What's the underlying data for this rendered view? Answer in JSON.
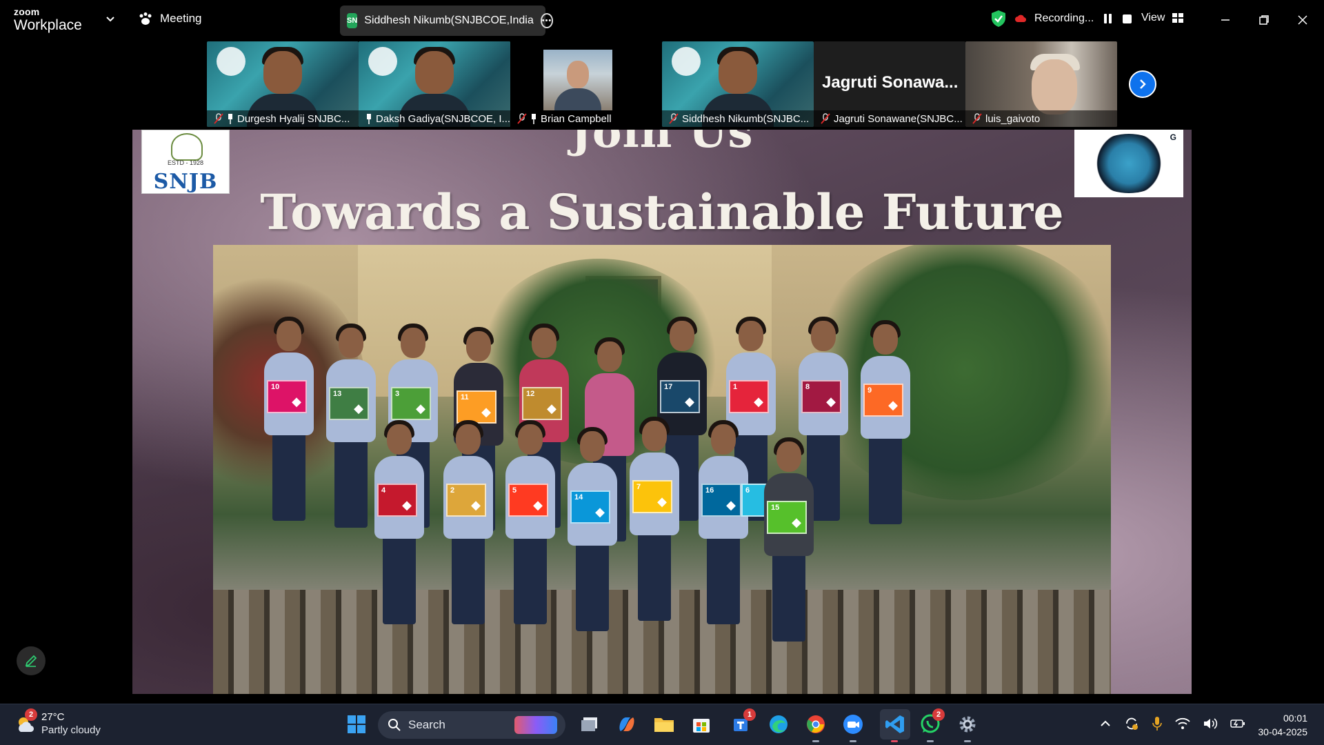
{
  "app": {
    "brand_small": "zoom",
    "brand_name": "Workplace",
    "meeting_label": "Meeting",
    "speaker_initials": "SN",
    "speaker_name": "Siddhesh Nikumb(SNJBCOE,India",
    "recording_label": "Recording...",
    "view_label": "View"
  },
  "participants": [
    {
      "name": "Durgesh Hyalij SNJBC...",
      "muted": true,
      "pinned": true,
      "type": "video"
    },
    {
      "name": "Daksh Gadiya(SNJBCOE, I...",
      "muted": false,
      "pinned": true,
      "type": "video",
      "active": true
    },
    {
      "name": "Brian Campbell",
      "muted": true,
      "pinned": true,
      "type": "photo"
    },
    {
      "name": "Siddhesh Nikumb(SNJBC...",
      "muted": true,
      "pinned": false,
      "type": "video"
    },
    {
      "name": "Jagruti Sonawane(SNJBC...",
      "muted": true,
      "pinned": false,
      "type": "name",
      "display_name": "Jagruti  Sonawa..."
    },
    {
      "name": "luis_gaivoto",
      "muted": true,
      "pinned": false,
      "type": "video"
    }
  ],
  "slide": {
    "title_top": "Join Us",
    "title": "Towards a Sustainable Future",
    "left_logo_word": "SNJB",
    "left_logo_estd": "ESTD - 1928",
    "right_logo_text": "G",
    "sdg_cards": [
      {
        "num": "10",
        "color": "#dd1367"
      },
      {
        "num": "13",
        "color": "#3f7e44"
      },
      {
        "num": "3",
        "color": "#4c9f38"
      },
      {
        "num": "11",
        "color": "#fd9d24"
      },
      {
        "num": "12",
        "color": "#bf8b2e"
      },
      {
        "num": "17",
        "color": "#19486a"
      },
      {
        "num": "1",
        "color": "#e5243b"
      },
      {
        "num": "8",
        "color": "#a21942"
      },
      {
        "num": "9",
        "color": "#fd6925"
      },
      {
        "num": "4",
        "color": "#c5192d"
      },
      {
        "num": "2",
        "color": "#dda63a"
      },
      {
        "num": "5",
        "color": "#ff3a21"
      },
      {
        "num": "14",
        "color": "#0a97d9"
      },
      {
        "num": "7",
        "color": "#fcc30b"
      },
      {
        "num": "16",
        "color": "#00689d"
      },
      {
        "num": "6",
        "color": "#26bde2"
      },
      {
        "num": "15",
        "color": "#56c02b"
      }
    ]
  },
  "taskbar": {
    "weather_temp": "27°C",
    "weather_desc": "Partly cloudy",
    "weather_badge": "2",
    "search_label": "Search",
    "store_badge": "1",
    "whatsapp_badge": "2",
    "time": "00:01",
    "date": "30-04-2025"
  }
}
